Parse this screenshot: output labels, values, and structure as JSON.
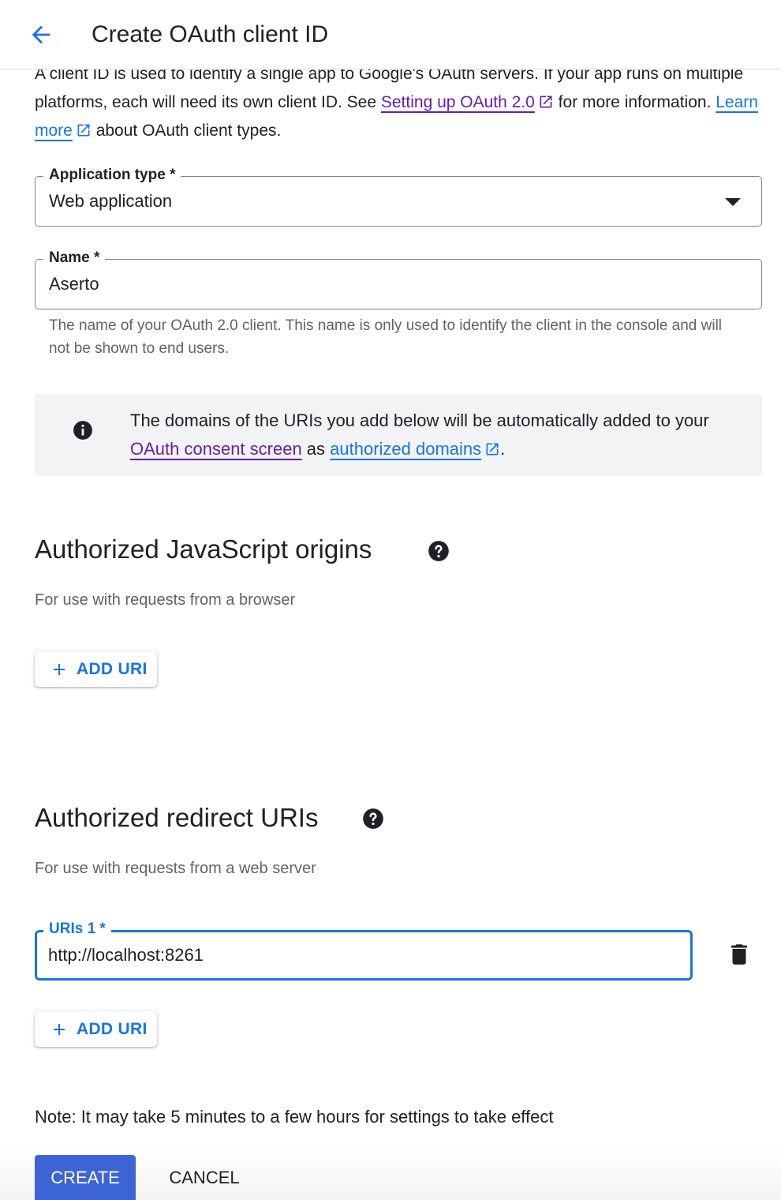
{
  "header": {
    "title": "Create OAuth client ID"
  },
  "intro": {
    "text1": "A client ID is used to identify a single app to Google's OAuth servers. If your app runs on multiple platforms, each will need its own client ID. See ",
    "link1": "Setting up OAuth 2.0",
    "text2": " for more information. ",
    "link2": "Learn more",
    "text3": " about OAuth client types."
  },
  "app_type": {
    "label": "Application type *",
    "value": "Web application"
  },
  "name_field": {
    "label": "Name *",
    "value": "Aserto",
    "hint": "The name of your OAuth 2.0 client. This name is only used to identify the client in the console and will not be shown to end users."
  },
  "info": {
    "text1": "The domains of the URIs you add below will be automatically added to your ",
    "link1": "OAuth consent screen",
    "text2": " as ",
    "link2": "authorized domains",
    "text3": "."
  },
  "js_origins": {
    "title": "Authorized JavaScript origins",
    "subtitle": "For use with requests from a browser",
    "add_label": "ADD URI"
  },
  "redirect_uris": {
    "title": "Authorized redirect URIs",
    "subtitle": "For use with requests from a web server",
    "uri_label": "URIs 1 *",
    "uri_value": "http://localhost:8261",
    "add_label": "ADD URI"
  },
  "note": "Note: It may take 5 minutes to a few hours for settings to take effect",
  "actions": {
    "create": "CREATE",
    "cancel": "CANCEL"
  },
  "colors": {
    "accent": "#1a73e8",
    "visited_link": "#681da8",
    "primary_button": "#3c64d4"
  }
}
